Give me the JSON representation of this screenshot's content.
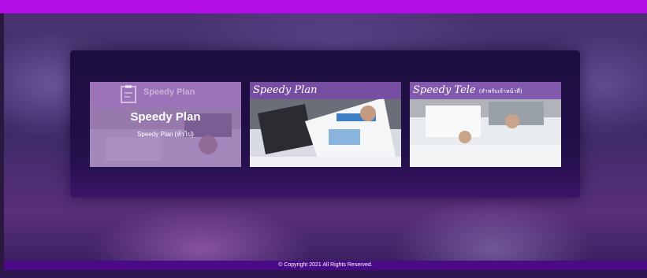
{
  "cards": [
    {
      "logo_text": "Speedy Plan",
      "title": "Speedy Plan",
      "subtitle": "Speedy Plan (ทั่วไป)",
      "icon": "clipboard-icon"
    },
    {
      "label": "Speedy Plan"
    },
    {
      "label": "Speedy Tele",
      "label_suffix": "(สำหรับเจ้าหน้าที่)"
    }
  ],
  "footer": {
    "copyright": "© Copyright 2021 All Rights Reserved."
  },
  "colors": {
    "top_bar": "#b20de6",
    "footer_bar": "#4a0a88",
    "panel": "#1c0d3e"
  }
}
